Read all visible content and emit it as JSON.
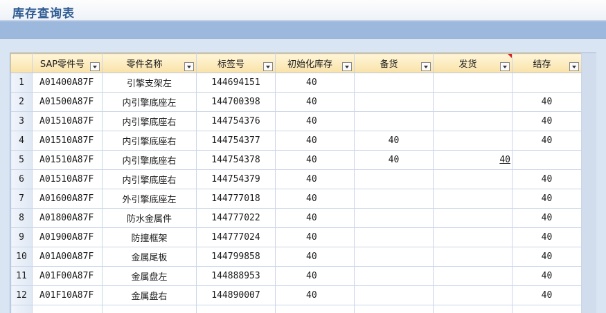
{
  "title": "库存查询表",
  "accent_colors": {
    "title": "#2e5b93",
    "band": "#9db8dd",
    "header": "#f9e2a8"
  },
  "columns": [
    "SAP零件号",
    "零件名称",
    "标签号",
    "初始化库存",
    "备货",
    "发货",
    "结存"
  ],
  "rows": [
    {
      "n": "1",
      "sap": "A01400A87F",
      "name": "引擎支架左",
      "tag": "144694151",
      "init": "40",
      "prep": "",
      "ship": "",
      "bal": ""
    },
    {
      "n": "2",
      "sap": "A01500A87F",
      "name": "内引擎底座左",
      "tag": "144700398",
      "init": "40",
      "prep": "",
      "ship": "",
      "bal": "40"
    },
    {
      "n": "3",
      "sap": "A01510A87F",
      "name": "内引擎底座右",
      "tag": "144754376",
      "init": "40",
      "prep": "",
      "ship": "",
      "bal": "40"
    },
    {
      "n": "4",
      "sap": "A01510A87F",
      "name": "内引擎底座右",
      "tag": "144754377",
      "init": "40",
      "prep": "40",
      "ship": "",
      "bal": "40"
    },
    {
      "n": "5",
      "sap": "A01510A87F",
      "name": "内引擎底座右",
      "tag": "144754378",
      "init": "40",
      "prep": "40",
      "ship": "40",
      "bal": ""
    },
    {
      "n": "6",
      "sap": "A01510A87F",
      "name": "内引擎底座右",
      "tag": "144754379",
      "init": "40",
      "prep": "",
      "ship": "",
      "bal": "40"
    },
    {
      "n": "7",
      "sap": "A01600A87F",
      "name": "外引擎底座左",
      "tag": "144777018",
      "init": "40",
      "prep": "",
      "ship": "",
      "bal": "40"
    },
    {
      "n": "8",
      "sap": "A01800A87F",
      "name": "防水金属件",
      "tag": "144777022",
      "init": "40",
      "prep": "",
      "ship": "",
      "bal": "40"
    },
    {
      "n": "9",
      "sap": "A01900A87F",
      "name": "防撞框架",
      "tag": "144777024",
      "init": "40",
      "prep": "",
      "ship": "",
      "bal": "40"
    },
    {
      "n": "10",
      "sap": "A01A00A87F",
      "name": "金属尾板",
      "tag": "144799858",
      "init": "40",
      "prep": "",
      "ship": "",
      "bal": "40"
    },
    {
      "n": "11",
      "sap": "A01F00A87F",
      "name": "金属盘左",
      "tag": "144888953",
      "init": "40",
      "prep": "",
      "ship": "",
      "bal": "40"
    },
    {
      "n": "12",
      "sap": "A01F10A87F",
      "name": "金属盘右",
      "tag": "144890007",
      "init": "40",
      "prep": "",
      "ship": "",
      "bal": "40"
    }
  ]
}
